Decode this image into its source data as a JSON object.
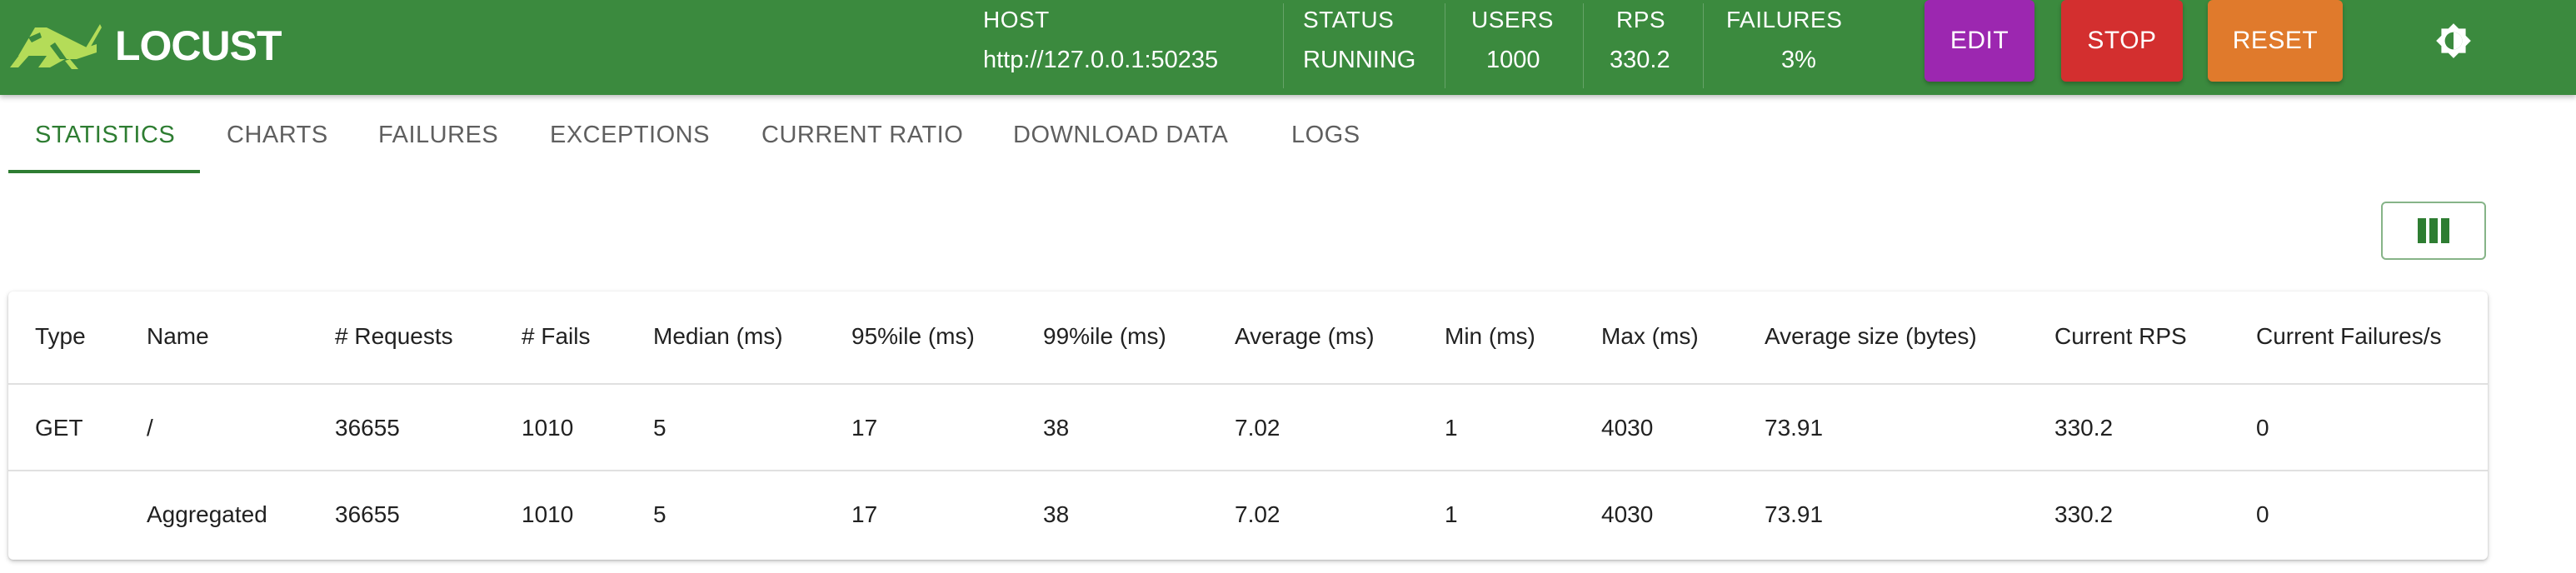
{
  "app": {
    "name": "LOCUST"
  },
  "header": {
    "stats": [
      {
        "label": "HOST",
        "value": "http://127.0.0.1:50235"
      },
      {
        "label": "STATUS",
        "value": "RUNNING"
      },
      {
        "label": "USERS",
        "value": "1000"
      },
      {
        "label": "RPS",
        "value": "330.2"
      },
      {
        "label": "FAILURES",
        "value": "3%"
      }
    ],
    "buttons": {
      "edit": "EDIT",
      "stop": "STOP",
      "reset": "RESET"
    },
    "theme_icon": "brightness-icon"
  },
  "tabs": [
    {
      "label": "STATISTICS",
      "active": true
    },
    {
      "label": "CHARTS"
    },
    {
      "label": "FAILURES"
    },
    {
      "label": "EXCEPTIONS"
    },
    {
      "label": "CURRENT RATIO"
    },
    {
      "label": "DOWNLOAD DATA"
    },
    {
      "label": "LOGS"
    }
  ],
  "column_picker_icon": "columns-icon",
  "table": {
    "columns": [
      "Type",
      "Name",
      "# Requests",
      "# Fails",
      "Median (ms)",
      "95%ile (ms)",
      "99%ile (ms)",
      "Average (ms)",
      "Min (ms)",
      "Max (ms)",
      "Average size (bytes)",
      "Current RPS",
      "Current Failures/s"
    ],
    "rows": [
      [
        "GET",
        "/",
        "36655",
        "1010",
        "5",
        "17",
        "38",
        "7.02",
        "1",
        "4030",
        "73.91",
        "330.2",
        "0"
      ],
      [
        "",
        "Aggregated",
        "36655",
        "1010",
        "5",
        "17",
        "38",
        "7.02",
        "1",
        "4030",
        "73.91",
        "330.2",
        "0"
      ]
    ]
  },
  "colors": {
    "header_bg": "#3b8a3e",
    "accent": "#2e7d32",
    "logo_green": "#b4dc58",
    "edit": "#9c27b0",
    "stop": "#d32f2f",
    "reset": "#e07a2c"
  }
}
